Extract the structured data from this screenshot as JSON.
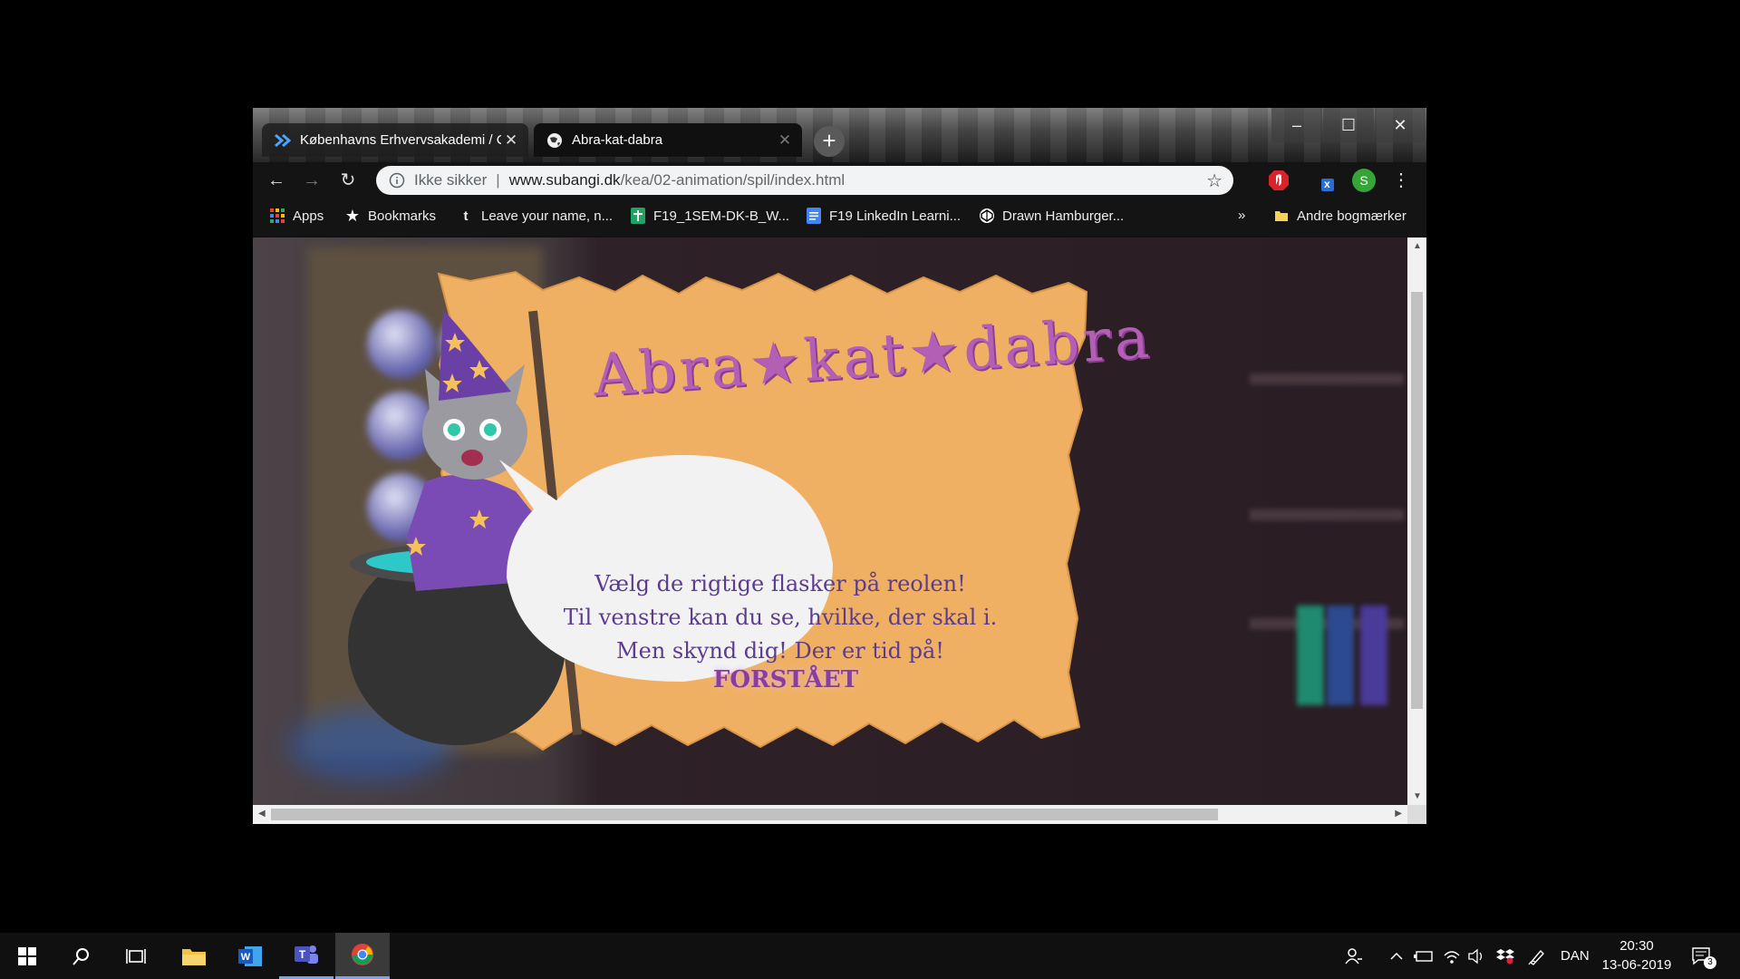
{
  "browser": {
    "tabs": [
      {
        "label": "Københavns Erhvervsakademi / C",
        "active": false
      },
      {
        "label": "Abra-kat-dabra",
        "active": true
      }
    ],
    "window_controls": {
      "minimize": "–",
      "maximize": "☐",
      "close": "✕"
    },
    "new_tab_label": "+",
    "nav": {
      "back": "←",
      "forward": "→",
      "reload": "↻"
    },
    "address": {
      "security_label": "Ikke sikker",
      "separator": "|",
      "domain": "www.subangi.dk",
      "path": "/kea/02-animation/spil/index.html"
    },
    "profile_initial": "S",
    "extension_badge": "x",
    "bookmarks": [
      {
        "label": "Apps",
        "icon": "apps-grid-icon"
      },
      {
        "label": "Bookmarks",
        "icon": "star-icon"
      },
      {
        "label": "Leave your name, n...",
        "icon": "tumblr-icon"
      },
      {
        "label": "F19_1SEM-DK-B_W...",
        "icon": "sheets-icon"
      },
      {
        "label": "F19 LinkedIn Learni...",
        "icon": "docs-icon"
      },
      {
        "label": "Drawn Hamburger...",
        "icon": "codepen-icon"
      }
    ],
    "bookmarks_overflow": "»",
    "other_bookmarks": "Andre bogmærker"
  },
  "game": {
    "title": "Abra★kat★dabra",
    "bubble_lines": [
      "Vælg de rigtige flasker på reolen!",
      "Til venstre kan du se, hvilke, der skal i.",
      "Men skynd dig! Der er tid på!"
    ],
    "confirm_button": "FORSTÅET",
    "colors": {
      "parchment": "#f0b063",
      "title": "#b35fb6",
      "text": "#5b3c8f",
      "bubble": "#f2f2f2"
    }
  },
  "taskbar": {
    "apps": [
      "windows-start-icon",
      "search-icon",
      "task-view-icon",
      "file-explorer-icon",
      "word-icon",
      "teams-icon",
      "chrome-icon"
    ],
    "language": "DAN",
    "time": "20:30",
    "date": "13-06-2019",
    "notification_count": "3"
  }
}
